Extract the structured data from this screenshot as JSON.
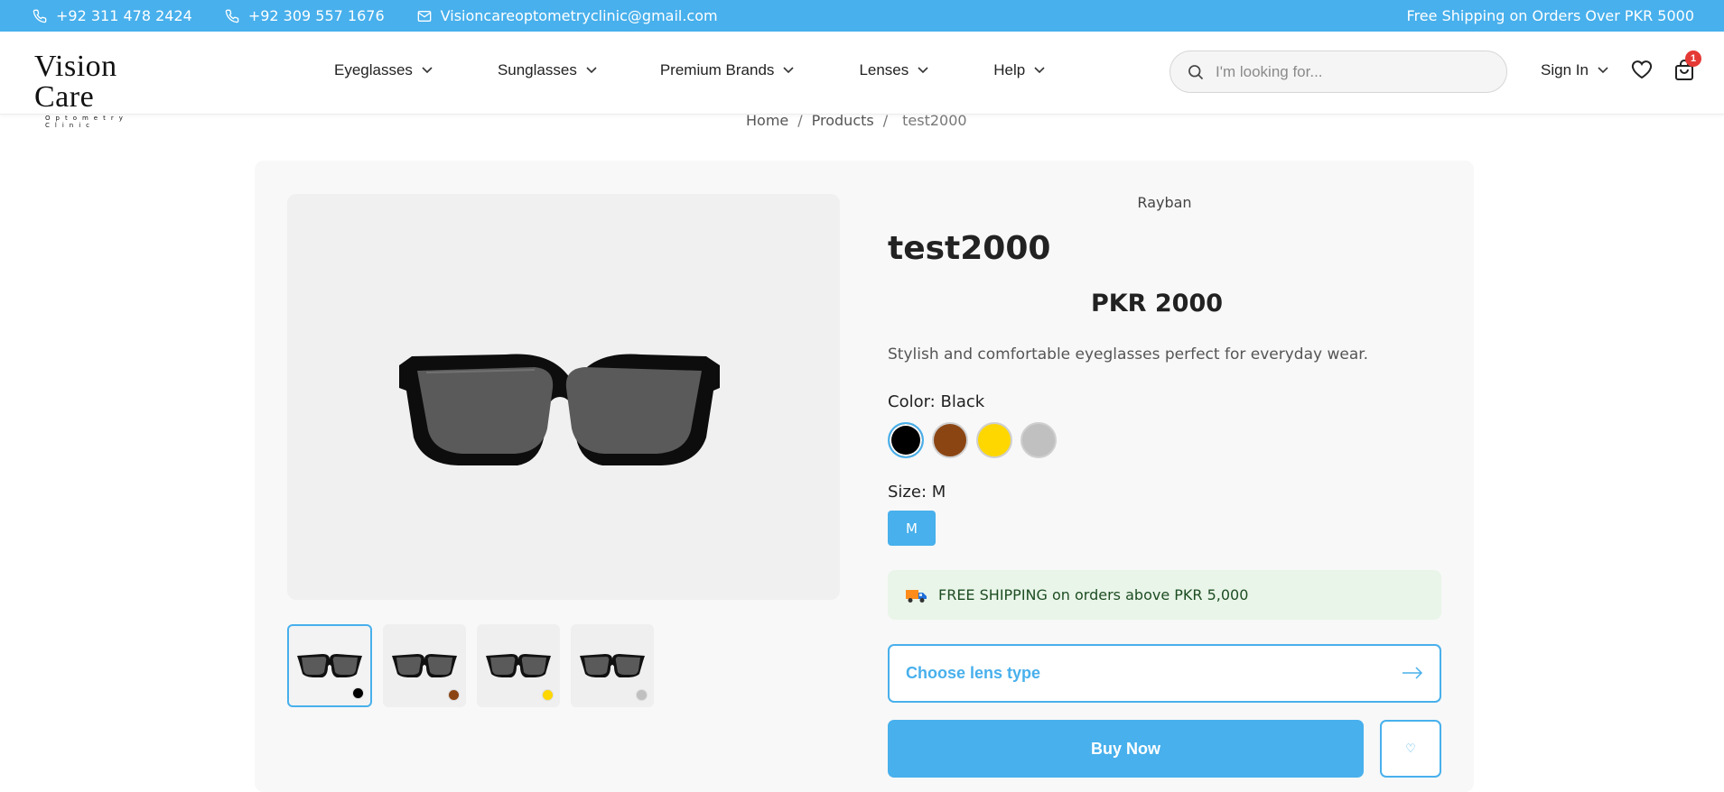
{
  "topbar": {
    "phone1": "+92 311 478 2424",
    "phone2": "+92 309 557 1676",
    "email": "Visioncareoptometryclinic@gmail.com",
    "promo": "Free Shipping on Orders Over PKR 5000"
  },
  "logo": {
    "brand": "Vision Care",
    "sub": "Optometry Clinic"
  },
  "nav": {
    "items": [
      {
        "label": "Eyeglasses"
      },
      {
        "label": "Sunglasses"
      },
      {
        "label": "Premium Brands"
      },
      {
        "label": "Lenses"
      },
      {
        "label": "Help"
      }
    ]
  },
  "search": {
    "placeholder": "I'm looking for..."
  },
  "account": {
    "signin_label": "Sign In",
    "cart_count": "1"
  },
  "breadcrumb": {
    "home": "Home",
    "products": "Products",
    "current": "test2000"
  },
  "product": {
    "brand": "Rayban",
    "title": "test2000",
    "price": "PKR 2000",
    "description": "Stylish and comfortable eyeglasses perfect for everyday wear.",
    "color_label": "Color: Black",
    "size_label": "Size: M",
    "size_value": "M",
    "colors": [
      "#000000",
      "#8b4513",
      "#ffd700",
      "#c0c0c0"
    ],
    "shipping_text": "FREE SHIPPING on orders above PKR 5,000",
    "lens_button": "Choose lens type",
    "buy_button": "Buy Now",
    "wishlist_symbol": "♡"
  },
  "colors": {
    "accent": "#48b0ec",
    "shipping_bg": "#e9f5e9",
    "badge": "#e53935"
  }
}
